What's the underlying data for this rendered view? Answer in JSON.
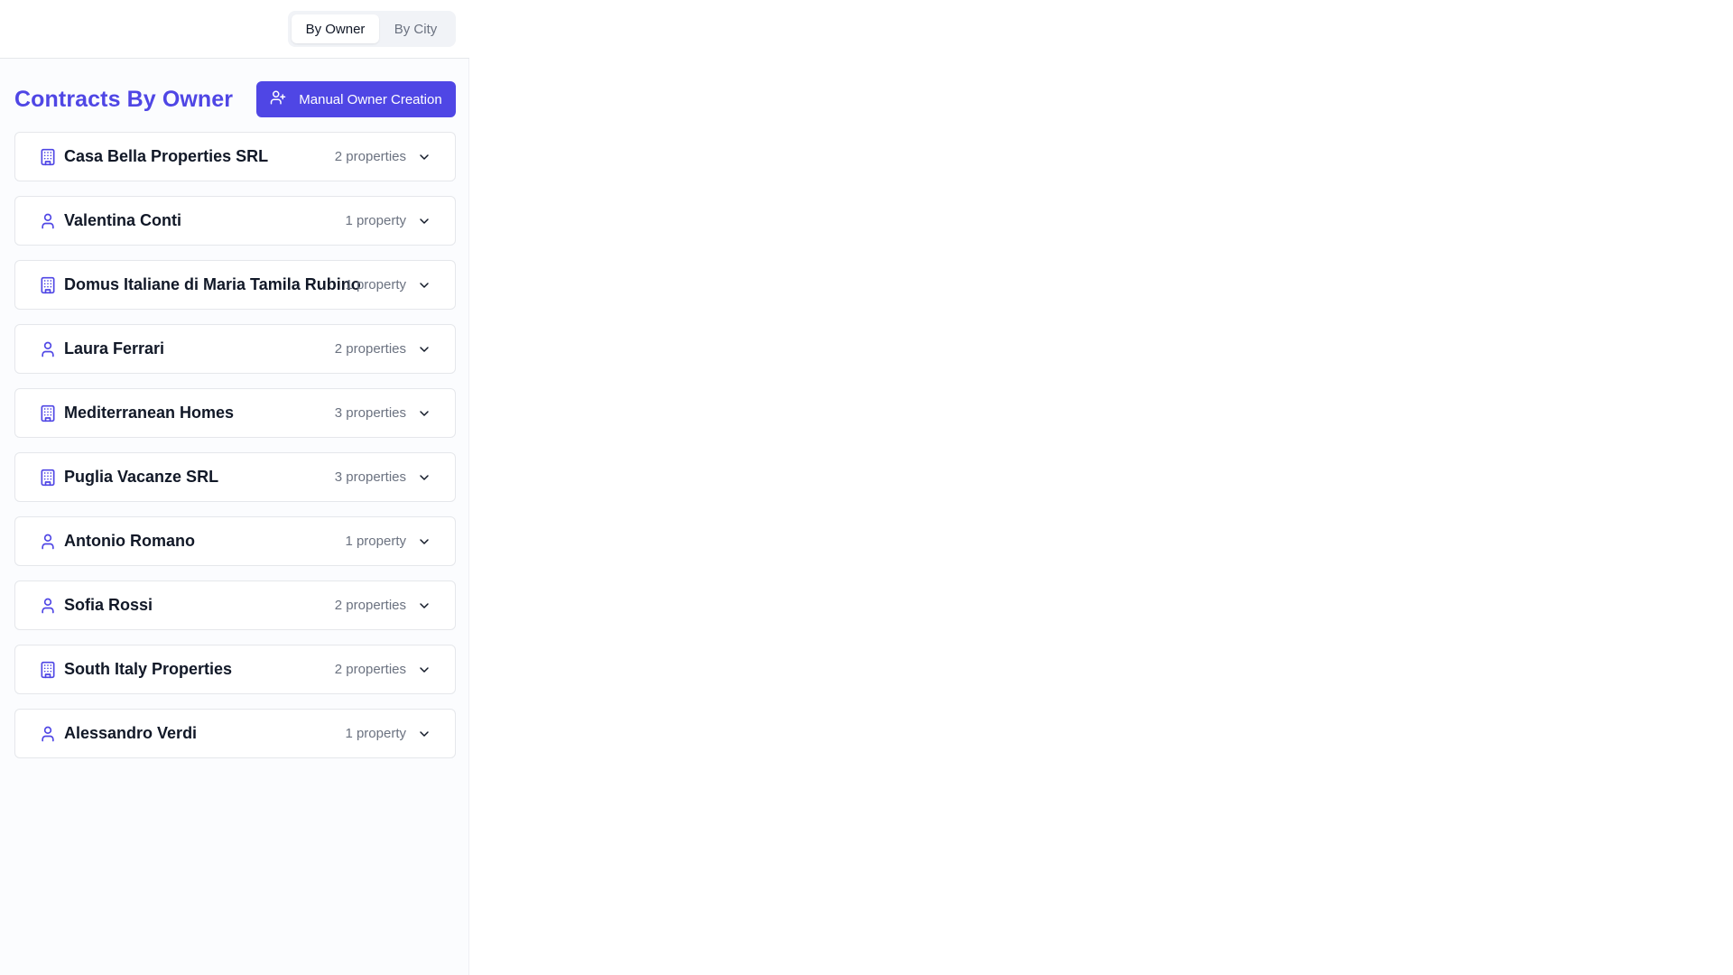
{
  "view_toggle": {
    "by_owner": "By Owner",
    "by_city": "By City",
    "active": "by_owner"
  },
  "header": {
    "title": "Contracts By Owner",
    "create_button_label": "Manual Owner Creation"
  },
  "colors": {
    "accent": "#4f46e5",
    "icon": "#4f46e5",
    "muted_text": "#6b7280"
  },
  "owners": [
    {
      "name": "Casa Bella Properties SRL",
      "count": "2 properties",
      "type": "company",
      "icon": "building-icon"
    },
    {
      "name": "Valentina Conti",
      "count": "1 property",
      "type": "person",
      "icon": "user-icon"
    },
    {
      "name": "Domus Italiane di Maria Tamila Rubino",
      "count": "1 property",
      "type": "company",
      "icon": "building-icon"
    },
    {
      "name": "Laura Ferrari",
      "count": "2 properties",
      "type": "person",
      "icon": "user-icon"
    },
    {
      "name": "Mediterranean Homes",
      "count": "3 properties",
      "type": "company",
      "icon": "building-icon"
    },
    {
      "name": "Puglia Vacanze SRL",
      "count": "3 properties",
      "type": "company",
      "icon": "building-icon"
    },
    {
      "name": "Antonio Romano",
      "count": "1 property",
      "type": "person",
      "icon": "user-icon"
    },
    {
      "name": "Sofia Rossi",
      "count": "2 properties",
      "type": "person",
      "icon": "user-icon"
    },
    {
      "name": "South Italy Properties",
      "count": "2 properties",
      "type": "company",
      "icon": "building-icon"
    },
    {
      "name": "Alessandro Verdi",
      "count": "1 property",
      "type": "person",
      "icon": "user-icon"
    }
  ]
}
